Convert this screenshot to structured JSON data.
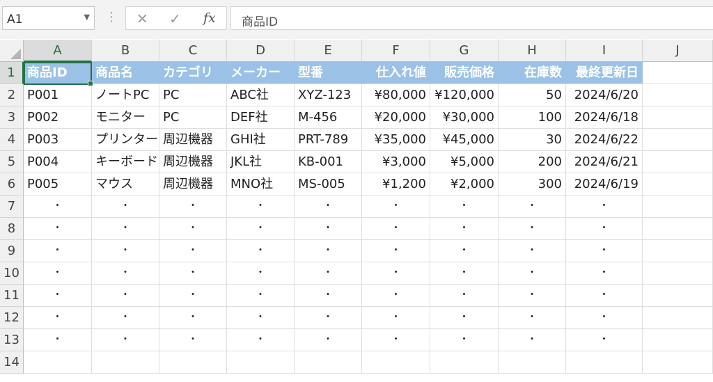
{
  "namebox": {
    "value": "A1"
  },
  "formula_bar": {
    "cancel_icon": "✕",
    "enter_icon": "✓",
    "fx_label": "fx",
    "content": "商品ID"
  },
  "columns": [
    "A",
    "B",
    "C",
    "D",
    "E",
    "F",
    "G",
    "H",
    "I",
    "J"
  ],
  "rows": [
    "1",
    "2",
    "3",
    "4",
    "5",
    "6",
    "7",
    "8",
    "9",
    "10",
    "11",
    "12",
    "13",
    "14"
  ],
  "header": [
    "商品ID",
    "商品名",
    "カテゴリ",
    "メーカー",
    "型番",
    "仕入れ値",
    "販売価格",
    "在庫数",
    "最終更新日"
  ],
  "data": [
    [
      "P001",
      "ノートPC",
      "PC",
      "ABC社",
      "XYZ-123",
      "¥80,000",
      "¥120,000",
      "50",
      "2024/6/20"
    ],
    [
      "P002",
      "モニター",
      "PC",
      "DEF社",
      "M-456",
      "¥20,000",
      "¥30,000",
      "100",
      "2024/6/18"
    ],
    [
      "P003",
      "プリンター",
      "周辺機器",
      "GHI社",
      "PRT-789",
      "¥35,000",
      "¥45,000",
      "30",
      "2024/6/22"
    ],
    [
      "P004",
      "キーボード",
      "周辺機器",
      "JKL社",
      "KB-001",
      "¥3,000",
      "¥5,000",
      "200",
      "2024/6/21"
    ],
    [
      "P005",
      "マウス",
      "周辺機器",
      "MNO社",
      "MS-005",
      "¥1,200",
      "¥2,000",
      "300",
      "2024/6/19"
    ]
  ],
  "ellipsis_mark": "・",
  "selected_cell": "A1",
  "colors": {
    "header_fill": "#9bc2e6",
    "selection": "#217346"
  }
}
